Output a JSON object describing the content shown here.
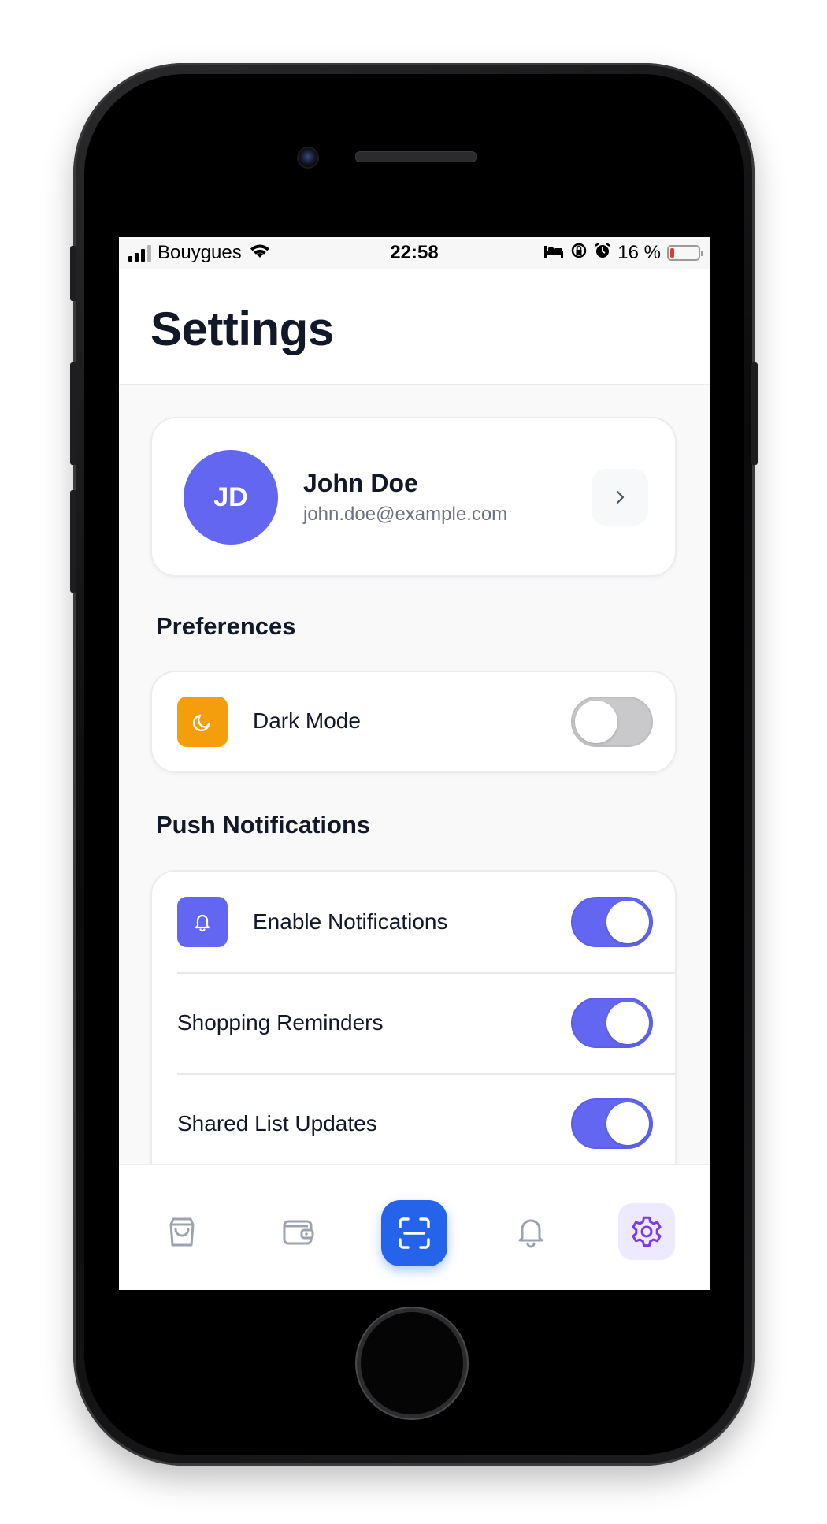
{
  "status_bar": {
    "carrier": "Bouygues",
    "time": "22:58",
    "battery_percent": "16 %",
    "battery_level": 0.16
  },
  "header": {
    "title": "Settings"
  },
  "profile": {
    "initials": "JD",
    "name": "John Doe",
    "email": "john.doe@example.com",
    "avatar_color": "#6366f1"
  },
  "preferences": {
    "section_title": "Preferences",
    "dark_mode": {
      "label": "Dark Mode",
      "enabled": false,
      "icon": "moon-icon",
      "icon_bg": "#f59e0b"
    }
  },
  "push_notifications": {
    "section_title": "Push Notifications",
    "rows": [
      {
        "label": "Enable Notifications",
        "enabled": true,
        "icon": "bell-icon",
        "icon_bg": "#6366f1"
      },
      {
        "label": "Shopping Reminders",
        "enabled": true
      },
      {
        "label": "Shared List Updates",
        "enabled": true
      }
    ]
  },
  "tab_bar": {
    "tabs": [
      {
        "icon": "shopping-bag-icon",
        "active": false
      },
      {
        "icon": "wallet-icon",
        "active": false
      },
      {
        "icon": "scan-icon",
        "active": false,
        "primary": true
      },
      {
        "icon": "bell-icon",
        "active": false
      },
      {
        "icon": "gear-icon",
        "active": true
      }
    ]
  },
  "colors": {
    "accent": "#6366f1",
    "scan_button": "#2563eb",
    "active_tab_bg": "#ede9fe",
    "active_tab_icon": "#7c3aed",
    "inactive_icon": "#9ca3af",
    "toggle_off": "#c9c9cc"
  }
}
